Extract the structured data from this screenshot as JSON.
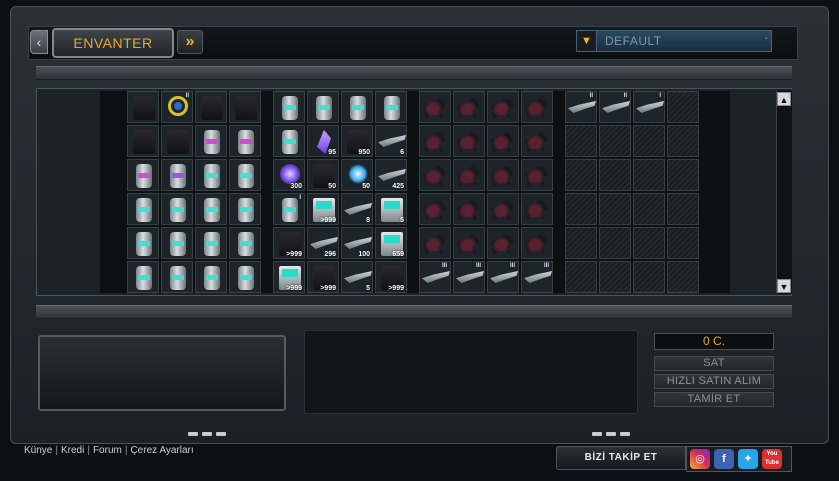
{
  "header": {
    "title": "ENVANTER",
    "filter_value": "DEFAULT"
  },
  "inventory": {
    "group1": [
      {
        "icon": "drone-icon",
        "kind": "dark"
      },
      {
        "icon": "ring-icon",
        "kind": "ring",
        "level": "II"
      },
      {
        "icon": "armor-icon",
        "kind": "dark"
      },
      {
        "icon": "armor-icon",
        "kind": "dark"
      },
      {
        "icon": "armor-icon",
        "kind": "dark"
      },
      {
        "icon": "armor-icon",
        "kind": "dark"
      },
      {
        "icon": "canister-icon",
        "kind": "can pink"
      },
      {
        "icon": "canister-icon",
        "kind": "can pink"
      },
      {
        "icon": "canister-icon",
        "kind": "can pink"
      },
      {
        "icon": "canister-icon",
        "kind": "can purple"
      },
      {
        "icon": "canister-icon",
        "kind": "can"
      },
      {
        "icon": "canister-icon",
        "kind": "can"
      },
      {
        "icon": "canister-icon",
        "kind": "can"
      },
      {
        "icon": "canister-icon",
        "kind": "can"
      },
      {
        "icon": "canister-icon",
        "kind": "can"
      },
      {
        "icon": "canister-icon",
        "kind": "can"
      },
      {
        "icon": "canister-icon",
        "kind": "can"
      },
      {
        "icon": "canister-icon",
        "kind": "can"
      },
      {
        "icon": "canister-icon",
        "kind": "can"
      },
      {
        "icon": "canister-icon",
        "kind": "can"
      },
      {
        "icon": "canister-icon",
        "kind": "can"
      },
      {
        "icon": "canister-icon",
        "kind": "can"
      },
      {
        "icon": "canister-icon",
        "kind": "can"
      },
      {
        "icon": "canister-icon",
        "kind": "can"
      }
    ],
    "group2": [
      {
        "icon": "canister-icon",
        "kind": "can"
      },
      {
        "icon": "canister-icon",
        "kind": "can"
      },
      {
        "icon": "canister-icon",
        "kind": "can"
      },
      {
        "icon": "canister-icon",
        "kind": "can"
      },
      {
        "icon": "canister-icon",
        "kind": "can"
      },
      {
        "icon": "crystal-icon",
        "kind": "gem",
        "qty": "95"
      },
      {
        "icon": "box-icon",
        "kind": "dark",
        "qty": "950"
      },
      {
        "icon": "hook-icon",
        "kind": "gun",
        "qty": "6"
      },
      {
        "icon": "orb-icon",
        "kind": "orb",
        "qty": "300"
      },
      {
        "icon": "robot-icon",
        "kind": "dark",
        "qty": "50"
      },
      {
        "icon": "spark-icon",
        "kind": "spark",
        "qty": "50"
      },
      {
        "icon": "rocket-icon",
        "kind": "gun",
        "qty": "425"
      },
      {
        "icon": "canister-icon",
        "kind": "can",
        "level": "I"
      },
      {
        "icon": "chip-icon",
        "kind": "chip",
        "qty": ">999"
      },
      {
        "icon": "missile-icon",
        "kind": "gun",
        "qty": "8"
      },
      {
        "icon": "chip-icon",
        "kind": "chip",
        "qty": "5"
      },
      {
        "icon": "ammo-box-icon",
        "kind": "dark",
        "qty": ">999"
      },
      {
        "icon": "rocket-icon",
        "kind": "gun",
        "qty": "296"
      },
      {
        "icon": "missile-icon",
        "kind": "gun",
        "qty": "100"
      },
      {
        "icon": "chip-icon",
        "kind": "chip",
        "qty": "659"
      },
      {
        "icon": "chip-icon",
        "kind": "chip",
        "qty": ">999"
      },
      {
        "icon": "ammo-box-icon",
        "kind": "dark",
        "qty": ">999"
      },
      {
        "icon": "rocket-icon",
        "kind": "gun",
        "qty": "5"
      },
      {
        "icon": "box-icon",
        "kind": "dark",
        "qty": ">999"
      }
    ],
    "group3": [
      {
        "icon": "ship-icon",
        "kind": "jet"
      },
      {
        "icon": "ship-icon",
        "kind": "jet"
      },
      {
        "icon": "ship-icon",
        "kind": "jet"
      },
      {
        "icon": "ship-icon",
        "kind": "jet"
      },
      {
        "icon": "ship-icon",
        "kind": "jet"
      },
      {
        "icon": "ship-icon",
        "kind": "jet"
      },
      {
        "icon": "ship-icon",
        "kind": "jet"
      },
      {
        "icon": "ship-icon",
        "kind": "jet"
      },
      {
        "icon": "ship-icon",
        "kind": "jet"
      },
      {
        "icon": "ship-icon",
        "kind": "jet"
      },
      {
        "icon": "ship-icon",
        "kind": "jet"
      },
      {
        "icon": "ship-icon",
        "kind": "jet"
      },
      {
        "icon": "ship-icon",
        "kind": "jet"
      },
      {
        "icon": "ship-icon",
        "kind": "jet"
      },
      {
        "icon": "ship-icon",
        "kind": "jet"
      },
      {
        "icon": "ship-icon",
        "kind": "jet"
      },
      {
        "icon": "ship-icon",
        "kind": "jet"
      },
      {
        "icon": "ship-icon",
        "kind": "jet"
      },
      {
        "icon": "ship-icon",
        "kind": "jet"
      },
      {
        "icon": "ship-icon",
        "kind": "jet"
      },
      {
        "icon": "laser-gun-icon",
        "kind": "gun",
        "level": "III"
      },
      {
        "icon": "laser-gun-icon",
        "kind": "gun",
        "level": "III"
      },
      {
        "icon": "laser-gun-icon",
        "kind": "gun",
        "level": "III"
      },
      {
        "icon": "laser-gun-icon",
        "kind": "gun",
        "level": "III"
      }
    ],
    "group4": [
      {
        "icon": "laser-gun-icon",
        "kind": "gun",
        "level": "II"
      },
      {
        "icon": "laser-gun-icon",
        "kind": "gun",
        "level": "II"
      },
      {
        "icon": "laser-gun-icon",
        "kind": "gun",
        "level": "I"
      },
      {
        "icon": "empty",
        "kind": "empty"
      }
    ],
    "group4_empty_rows": 5
  },
  "actions": {
    "credits": "0 C.",
    "sell": "SAT",
    "quick_sell": "HIZLI SATIN ALIM",
    "repair": "TAMİR ET"
  },
  "footer": {
    "links": [
      "Künye",
      "Kredi",
      "Forum",
      "Çerez Ayarları"
    ],
    "follow_label": "BİZİ TAKİP ET",
    "socials": [
      {
        "name": "instagram-icon",
        "glyph": "◎"
      },
      {
        "name": "facebook-icon",
        "glyph": "f"
      },
      {
        "name": "twitter-icon",
        "glyph": "✦"
      },
      {
        "name": "youtube-icon",
        "glyph": "You Tube"
      }
    ]
  }
}
